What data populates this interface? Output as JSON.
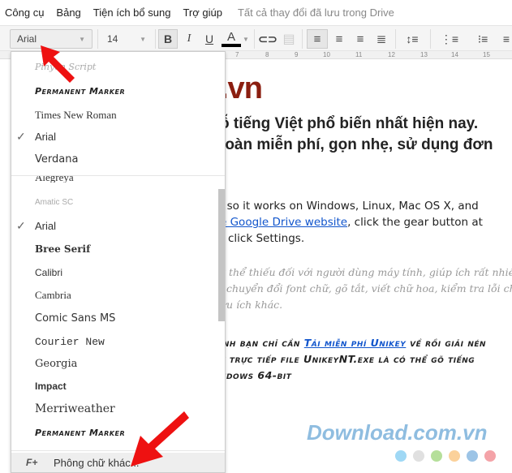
{
  "menubar": {
    "items": [
      "Công cụ",
      "Bảng",
      "Tiện ích bổ sung",
      "Trợ giúp"
    ],
    "status": "Tất cả thay đổi đã lưu trong Drive"
  },
  "toolbar": {
    "font": "Arial",
    "size": "14",
    "bold": "B",
    "italic": "I",
    "underline": "U",
    "text_color": "A",
    "text_color_value": "#000000"
  },
  "ruler": [
    "7",
    "8",
    "9",
    "10",
    "11",
    "12",
    "13",
    "14",
    "15"
  ],
  "font_menu": {
    "recent": [
      {
        "label": "Pinyon Script"
      },
      {
        "label": "Permanent Marker"
      },
      {
        "label": "Times New Roman"
      },
      {
        "label": "Arial",
        "checked": true
      },
      {
        "label": "Verdana"
      }
    ],
    "all": [
      {
        "label": "Alegreya"
      },
      {
        "label": "Amatic SC"
      },
      {
        "label": "Arial",
        "checked": true
      },
      {
        "label": "Bree Serif"
      },
      {
        "label": "Calibri"
      },
      {
        "label": "Cambria"
      },
      {
        "label": "Comic Sans MS"
      },
      {
        "label": "Courier New"
      },
      {
        "label": "Georgia"
      },
      {
        "label": "Impact"
      },
      {
        "label": "Merriweather"
      },
      {
        "label": "Permanent Marker"
      }
    ],
    "check": "✓",
    "more_icon": "F+",
    "more_label": "Phông chữ khác..."
  },
  "document": {
    "title_fragment": ".vn",
    "heading": [
      "ỗ tiếng Việt phổ biến nhất hiện nay.",
      "toàn miễn phí, gọn nhẹ, sử dụng đơn"
    ],
    "body1_a": ", so it works on Windows, Linux, Mac OS X, and",
    "body1_link": "e Google Drive website",
    "body1_b": ", click the gear button at",
    "body1_c": "click Settings.",
    "script": [
      "y thể thiếu đối với người dùng máy tính, giúp ích rất nhiều",
      ", chuyển đổi font chữ, gõ tắt, viết chữ hoa, kiểm tra lỗi chính",
      "ữu ích khác."
    ],
    "marker1_a": "ính bạn chỉ cần ",
    "marker1_link": "Tải miễn phí Unikey",
    "marker1_b": " về rồi giải nén",
    "marker2": "y trực tiếp file UnikeyNT.exe là có thể gõ tiếng",
    "marker3": "ndows 64-bit"
  },
  "watermark": {
    "text": "Download.com.vn",
    "dots": [
      "#9fd8f5",
      "#e0e0e0",
      "#b5df9a",
      "#fbd19a",
      "#9cc4e6",
      "#f4a3a8"
    ]
  },
  "colors": {
    "title": "#8b1e10",
    "link": "#1155cc",
    "arrow": "#ee1111"
  }
}
